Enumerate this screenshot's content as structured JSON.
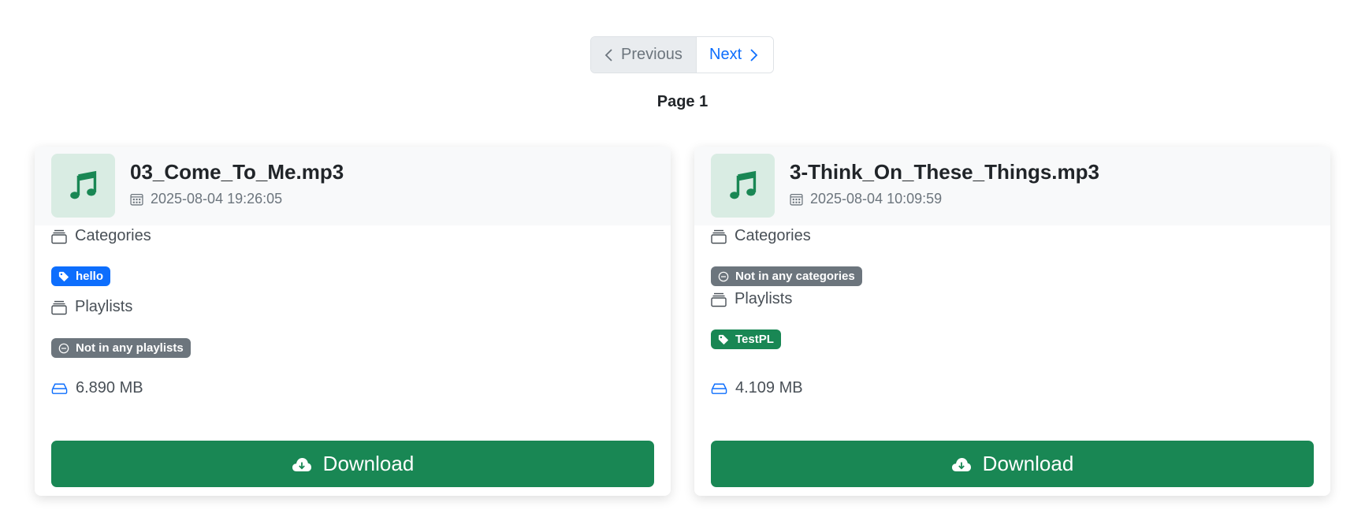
{
  "pagination": {
    "previous_label": "Previous",
    "next_label": "Next",
    "page_label": "Page 1"
  },
  "cards": [
    {
      "file_name": "03_Come_To_Me.mp3",
      "date": "2025-08-04 19:26:05",
      "categories_label": "Categories",
      "categories": [
        "hello"
      ],
      "categories_empty": false,
      "playlists_label": "Playlists",
      "playlists_empty_label": "Not in any playlists",
      "playlists": [],
      "size": "6.890 MB",
      "download_label": "Download"
    },
    {
      "file_name": "3-Think_On_These_Things.mp3",
      "date": "2025-08-04 10:09:59",
      "categories_label": "Categories",
      "categories_empty_label": "Not in any categories",
      "categories": [],
      "playlists_label": "Playlists",
      "playlists": [
        "TestPL"
      ],
      "size": "4.109 MB",
      "download_label": "Download"
    }
  ],
  "colors": {
    "primary": "#0d6efd",
    "success": "#198754",
    "secondary": "#6c757d",
    "thumb_bg": "#d9ece3"
  },
  "icons": {
    "thumb": "music-note-icon",
    "date": "calendar-icon",
    "section": "collection-icon",
    "category_badge": "tag-icon",
    "empty_badge": "dash-circle-icon",
    "size": "hdd-icon",
    "download": "cloud-download-icon",
    "prev": "chevron-left-icon",
    "next": "chevron-right-icon"
  }
}
